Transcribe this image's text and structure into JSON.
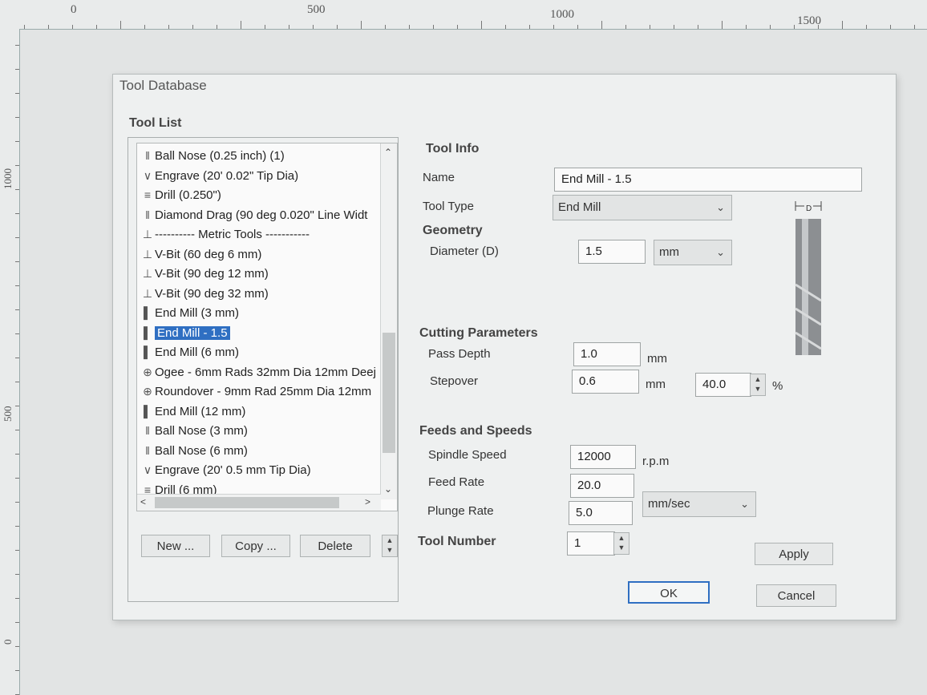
{
  "ruler": {
    "top_labels": [
      "0",
      "500",
      "1000",
      "1500"
    ],
    "left_labels": [
      "1000",
      "500",
      "0"
    ]
  },
  "dialog": {
    "title": "Tool Database",
    "tool_list_title": "Tool List",
    "tool_list": [
      {
        "label": "Ball Nose (0.25 inch) (1)",
        "icon": "ball-nose-icon",
        "selected": false
      },
      {
        "label": "Engrave (20' 0.02\" Tip Dia)",
        "icon": "engrave-icon",
        "selected": false
      },
      {
        "label": "Drill (0.250\")",
        "icon": "drill-icon",
        "selected": false
      },
      {
        "label": "Diamond Drag (90 deg 0.020\" Line Widt",
        "icon": "diamond-drag-icon",
        "selected": false
      },
      {
        "label": "---------- Metric Tools -----------",
        "icon": "group-icon",
        "selected": false
      },
      {
        "label": "V-Bit (60 deg 6 mm)",
        "icon": "v-bit-icon",
        "selected": false
      },
      {
        "label": "V-Bit (90 deg 12 mm)",
        "icon": "v-bit-icon",
        "selected": false
      },
      {
        "label": "V-Bit (90 deg 32 mm)",
        "icon": "v-bit-icon",
        "selected": false
      },
      {
        "label": "End Mill (3 mm)",
        "icon": "end-mill-icon",
        "selected": false
      },
      {
        "label": "End Mill - 1.5",
        "icon": "end-mill-icon",
        "selected": true
      },
      {
        "label": "End Mill (6 mm)",
        "icon": "end-mill-icon",
        "selected": false
      },
      {
        "label": "Ogee - 6mm Rads 32mm Dia 12mm Deej",
        "icon": "form-tool-icon",
        "selected": false
      },
      {
        "label": "Roundover - 9mm Rad 25mm Dia 12mm",
        "icon": "form-tool-icon",
        "selected": false
      },
      {
        "label": "End Mill (12 mm)",
        "icon": "end-mill-icon",
        "selected": false
      },
      {
        "label": "Ball Nose (3 mm)",
        "icon": "ball-nose-icon",
        "selected": false
      },
      {
        "label": "Ball Nose (6 mm)",
        "icon": "ball-nose-icon",
        "selected": false
      },
      {
        "label": "Engrave (20' 0.5 mm Tip Dia)",
        "icon": "engrave-icon",
        "selected": false
      },
      {
        "label": "Drill (6 mm)",
        "icon": "drill-icon",
        "selected": false
      }
    ],
    "list_buttons": {
      "new": "New ...",
      "copy": "Copy ...",
      "delete": "Delete"
    },
    "tool_info": {
      "title": "Tool Info",
      "name_label": "Name",
      "name_value": "End Mill - 1.5",
      "tool_type_label": "Tool Type",
      "tool_type_value": "End Mill",
      "diameter_marker": "D"
    },
    "geometry": {
      "title": "Geometry",
      "diameter_label": "Diameter (D)",
      "diameter_value": "1.5",
      "unit": "mm"
    },
    "cutting": {
      "title": "Cutting Parameters",
      "pass_depth_label": "Pass Depth",
      "pass_depth_value": "1.0",
      "pass_depth_unit": "mm",
      "stepover_label": "Stepover",
      "stepover_value": "0.6",
      "stepover_unit": "mm",
      "stepover_percent": "40.0",
      "percent_sign": "%"
    },
    "feeds": {
      "title": "Feeds and Speeds",
      "spindle_label": "Spindle Speed",
      "spindle_value": "12000",
      "spindle_unit": "r.p.m",
      "feed_label": "Feed Rate",
      "feed_value": "20.0",
      "plunge_label": "Plunge Rate",
      "plunge_value": "5.0",
      "rate_unit": "mm/sec"
    },
    "tool_number": {
      "label": "Tool Number",
      "value": "1"
    },
    "buttons": {
      "apply": "Apply",
      "ok": "OK",
      "cancel": "Cancel"
    }
  }
}
